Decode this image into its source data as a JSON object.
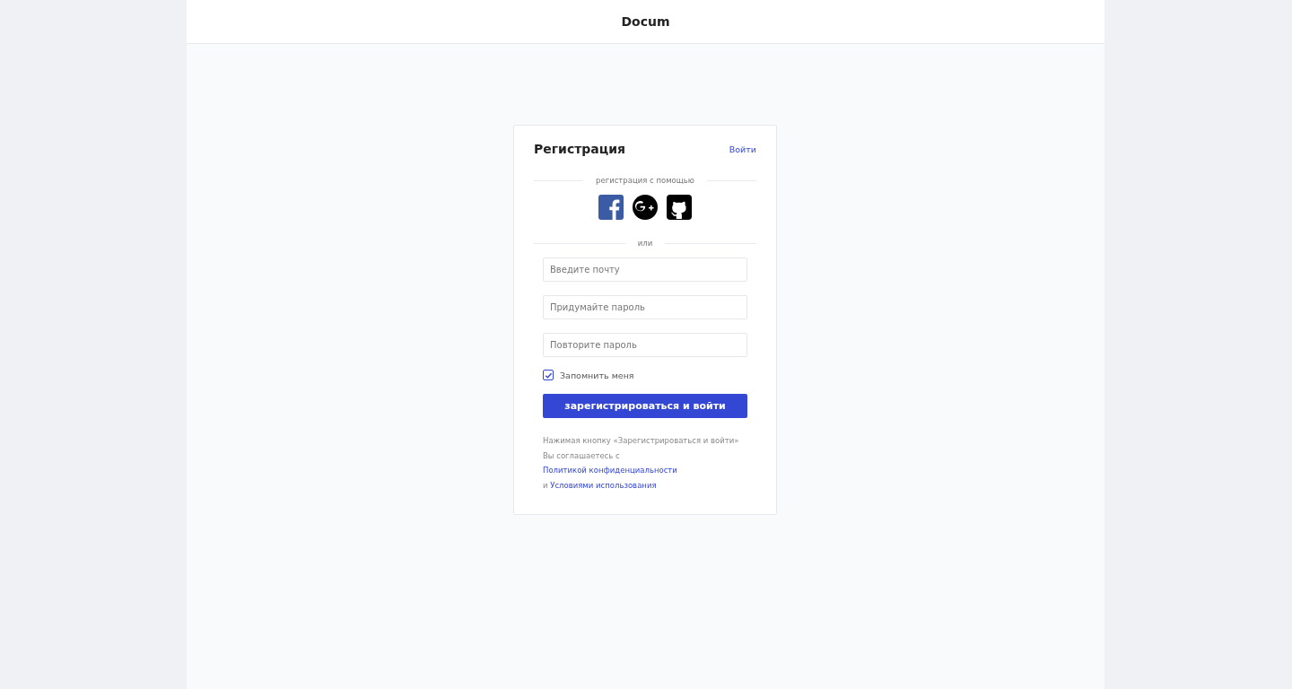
{
  "header": {
    "logo": "Docum"
  },
  "card": {
    "title": "Регистрация",
    "login_link": "Войти",
    "social_caption": "регистрация с помощью",
    "social": [
      {
        "kind": "facebook"
      },
      {
        "kind": "google-plus"
      },
      {
        "kind": "github"
      }
    ],
    "or_caption": "или",
    "fields": [
      {
        "placeholder": "Введите почту"
      },
      {
        "placeholder": "Придумайте пароль"
      },
      {
        "placeholder": "Повторите пароль"
      }
    ],
    "remember": {
      "label": "Запомнить меня",
      "checked": true
    },
    "submit": "зарегистрироваться и войти",
    "terms": {
      "line_1": "Нажимая кнопку «Зарегистрироваться и войти»",
      "line_2": "Вы соглашаетесь с",
      "privacy_link": "Политикой конфиденциальности",
      "line_3": "и",
      "terms_link": "Условиями использования"
    }
  }
}
